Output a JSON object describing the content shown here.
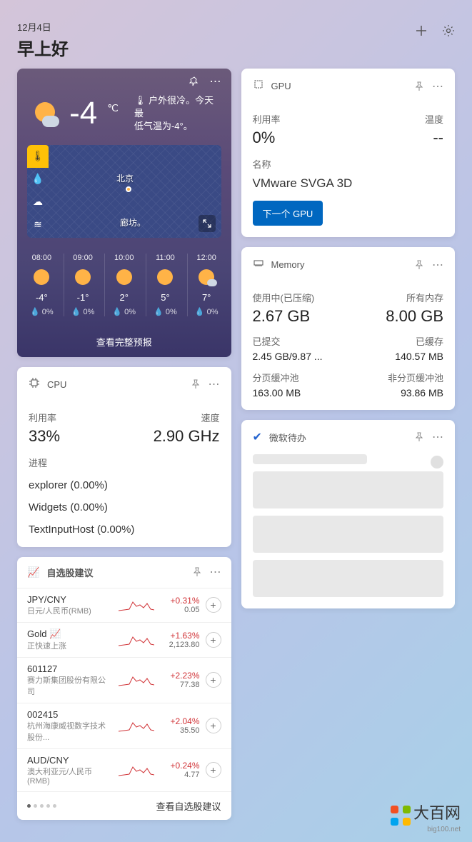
{
  "header": {
    "date": "12月4日",
    "greeting": "早上好"
  },
  "weather": {
    "temp": "-4",
    "unit": "℃",
    "desc_line1": "🌡 户外很冷。今天最",
    "desc_line2": "低气温为-4°。",
    "city": "北京",
    "city2": "廊坊。",
    "hours": [
      {
        "t": "08:00",
        "temp": "-4°",
        "pr": "💧 0%",
        "cloud": false
      },
      {
        "t": "09:00",
        "temp": "-1°",
        "pr": "💧 0%",
        "cloud": false
      },
      {
        "t": "10:00",
        "temp": "2°",
        "pr": "💧 0%",
        "cloud": false
      },
      {
        "t": "11:00",
        "temp": "5°",
        "pr": "💧 0%",
        "cloud": false
      },
      {
        "t": "12:00",
        "temp": "7°",
        "pr": "💧 0%",
        "cloud": true
      }
    ],
    "link": "查看完整预报"
  },
  "cpu": {
    "title": "CPU",
    "util_label": "利用率",
    "util": "33%",
    "speed_label": "速度",
    "speed": "2.90 GHz",
    "proc_label": "进程",
    "procs": [
      "explorer (0.00%)",
      "Widgets (0.00%)",
      "TextInputHost (0.00%)"
    ]
  },
  "gpu": {
    "title": "GPU",
    "util_label": "利用率",
    "util": "0%",
    "temp_label": "温度",
    "temp": "--",
    "name_label": "名称",
    "name": "VMware SVGA 3D",
    "btn": "下一个 GPU"
  },
  "memory": {
    "title": "Memory",
    "used_label": "使用中(已压缩)",
    "used": "2.67 GB",
    "total_label": "所有内存",
    "total": "8.00 GB",
    "commit_label": "已提交",
    "commit": "2.45 GB/9.87 ...",
    "cached_label": "已缓存",
    "cached": "140.57 MB",
    "paged_label": "分页缓冲池",
    "paged": "163.00 MB",
    "nonpaged_label": "非分页缓冲池",
    "nonpaged": "93.86 MB"
  },
  "todo": {
    "title": "微软待办"
  },
  "stocks": {
    "title": "自选股建议",
    "items": [
      {
        "sym": "JPY/CNY",
        "sub": "日元/人民币(RMB)",
        "chg": "+0.31%",
        "prc": "0.05"
      },
      {
        "sym": "Gold 📈",
        "sub": "正快速上涨",
        "sub_red": true,
        "chg": "+1.63%",
        "prc": "2,123.80"
      },
      {
        "sym": "601127",
        "sub": "赛力斯集团股份有限公司",
        "chg": "+2.23%",
        "prc": "77.38"
      },
      {
        "sym": "002415",
        "sub": "杭州海康威视数字技术股份...",
        "chg": "+2.04%",
        "prc": "35.50"
      },
      {
        "sym": "AUD/CNY",
        "sub": "澳大利亚元/人民币(RMB)",
        "chg": "+0.24%",
        "prc": "4.77"
      }
    ],
    "link": "查看自选股建议"
  },
  "watermark": {
    "brand": "大百网",
    "url": "big100.net"
  }
}
